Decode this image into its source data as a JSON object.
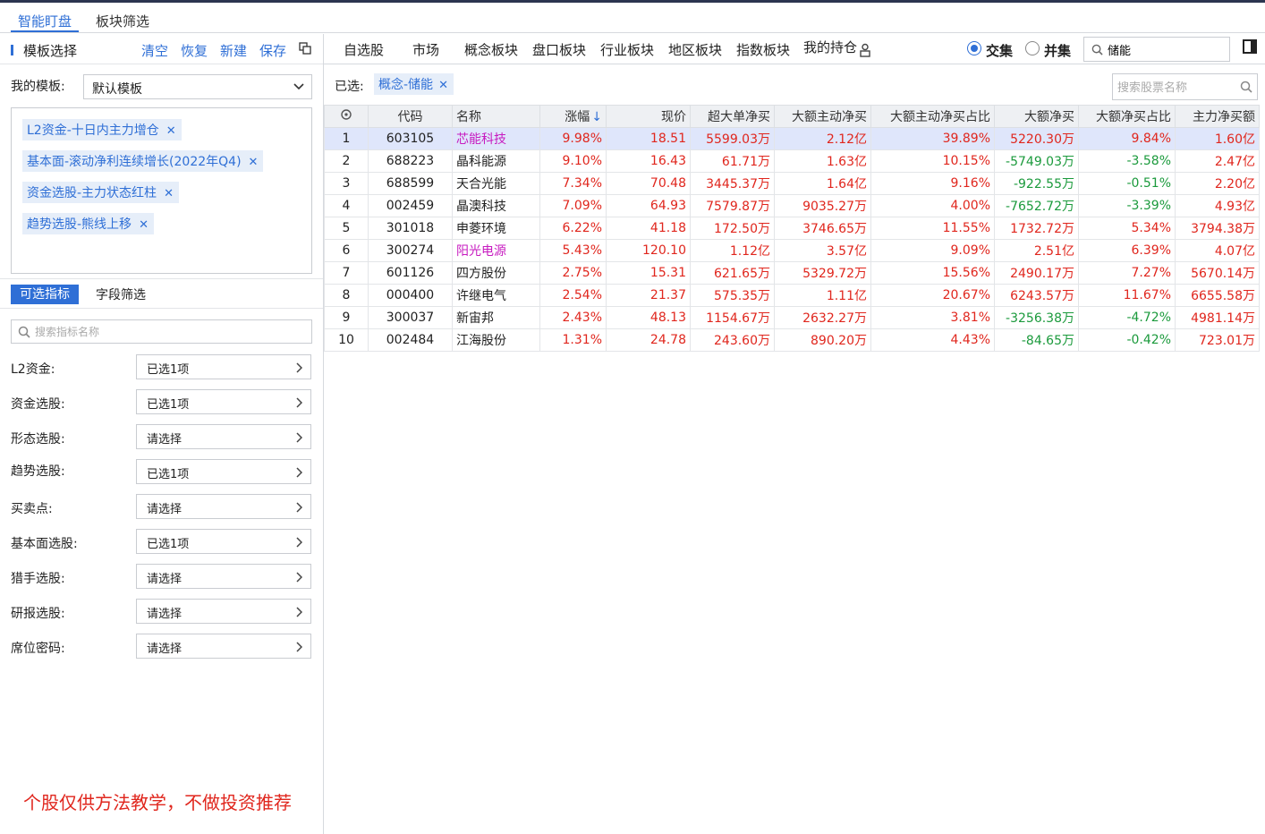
{
  "tabs": [
    {
      "label": "智能盯盘"
    },
    {
      "label": "板块筛选"
    }
  ],
  "left": {
    "header_title": "模板选择",
    "actions": [
      "清空",
      "恢复",
      "新建",
      "保存"
    ],
    "template_label": "我的模板:",
    "template_value": "默认模板",
    "tags": [
      "L2资金-十日内主力增仓",
      "基本面-滚动净利连续增长(2022年Q4)",
      "资金选股-主力状态红柱",
      "趋势选股-熊线上移"
    ],
    "subtabs": [
      "可选指标",
      "字段筛选"
    ],
    "indicator_search_placeholder": "搜索指标名称",
    "filters": [
      {
        "label": "L2资金:",
        "value": "已选1项"
      },
      {
        "label": "资金选股:",
        "value": "已选1项"
      },
      {
        "label": "形态选股:",
        "value": "请选择"
      },
      {
        "label": "趋势选股:",
        "value": "已选1项"
      },
      {
        "label": "买卖点:",
        "value": "请选择"
      },
      {
        "label": "基本面选股:",
        "value": "已选1项"
      },
      {
        "label": "猎手选股:",
        "value": "请选择"
      },
      {
        "label": "研报选股:",
        "value": "请选择"
      },
      {
        "label": "席位密码:",
        "value": "请选择"
      }
    ],
    "disclaimer": "个股仅供方法教学，不做投资推荐"
  },
  "right": {
    "nav": [
      "自选股",
      "市场",
      "概念板块",
      "盘口板块",
      "行业板块",
      "地区板块",
      "指数板块",
      "我的持仓"
    ],
    "radio_intersect": "交集",
    "radio_union": "并集",
    "search_value": "储能",
    "selected_label": "已选:",
    "selected_tag": "概念-储能",
    "stock_search_placeholder": "搜索股票名称",
    "columns": [
      "代码",
      "名称",
      "涨幅",
      "现价",
      "超大单净买",
      "大额主动净买",
      "大额主动净买占比",
      "大额净买",
      "大额净买占比",
      "主力净买额"
    ],
    "rows": [
      {
        "idx": "1",
        "code": "603105",
        "name": "芯能科技",
        "name_color": "pink",
        "vals": [
          "9.98%",
          "18.51",
          "5599.03万",
          "2.12亿",
          "39.89%",
          "5220.30万",
          "9.84%",
          "1.60亿"
        ]
      },
      {
        "idx": "2",
        "code": "688223",
        "name": "晶科能源",
        "name_color": "black",
        "vals": [
          "9.10%",
          "16.43",
          "61.71万",
          "1.63亿",
          "10.15%",
          "-5749.03万",
          "-3.58%",
          "2.47亿"
        ]
      },
      {
        "idx": "3",
        "code": "688599",
        "name": "天合光能",
        "name_color": "black",
        "vals": [
          "7.34%",
          "70.48",
          "3445.37万",
          "1.64亿",
          "9.16%",
          "-922.55万",
          "-0.51%",
          "2.20亿"
        ]
      },
      {
        "idx": "4",
        "code": "002459",
        "name": "晶澳科技",
        "name_color": "black",
        "vals": [
          "7.09%",
          "64.93",
          "7579.87万",
          "9035.27万",
          "4.00%",
          "-7652.72万",
          "-3.39%",
          "4.93亿"
        ]
      },
      {
        "idx": "5",
        "code": "301018",
        "name": "申菱环境",
        "name_color": "black",
        "vals": [
          "6.22%",
          "41.18",
          "172.50万",
          "3746.65万",
          "11.55%",
          "1732.72万",
          "5.34%",
          "3794.38万"
        ]
      },
      {
        "idx": "6",
        "code": "300274",
        "name": "阳光电源",
        "name_color": "pink",
        "vals": [
          "5.43%",
          "120.10",
          "1.12亿",
          "3.57亿",
          "9.09%",
          "2.51亿",
          "6.39%",
          "4.07亿"
        ]
      },
      {
        "idx": "7",
        "code": "601126",
        "name": "四方股份",
        "name_color": "black",
        "vals": [
          "2.75%",
          "15.31",
          "621.65万",
          "5329.72万",
          "15.56%",
          "2490.17万",
          "7.27%",
          "5670.14万"
        ]
      },
      {
        "idx": "8",
        "code": "000400",
        "name": "许继电气",
        "name_color": "black",
        "vals": [
          "2.54%",
          "21.37",
          "575.35万",
          "1.11亿",
          "20.67%",
          "6243.57万",
          "11.67%",
          "6655.58万"
        ]
      },
      {
        "idx": "9",
        "code": "300037",
        "name": "新宙邦",
        "name_color": "black",
        "vals": [
          "2.43%",
          "48.13",
          "1154.67万",
          "2632.27万",
          "3.81%",
          "-3256.38万",
          "-4.72%",
          "4981.14万"
        ]
      },
      {
        "idx": "10",
        "code": "002484",
        "name": "江海股份",
        "name_color": "black",
        "vals": [
          "1.31%",
          "24.78",
          "243.60万",
          "890.20万",
          "4.43%",
          "-84.65万",
          "-0.42%",
          "723.01万"
        ]
      }
    ]
  },
  "colors": {
    "accent": "#2f6fd6",
    "up": "#e0261d",
    "down": "#1b9a3c",
    "highlight_name": "#c71bc0"
  }
}
